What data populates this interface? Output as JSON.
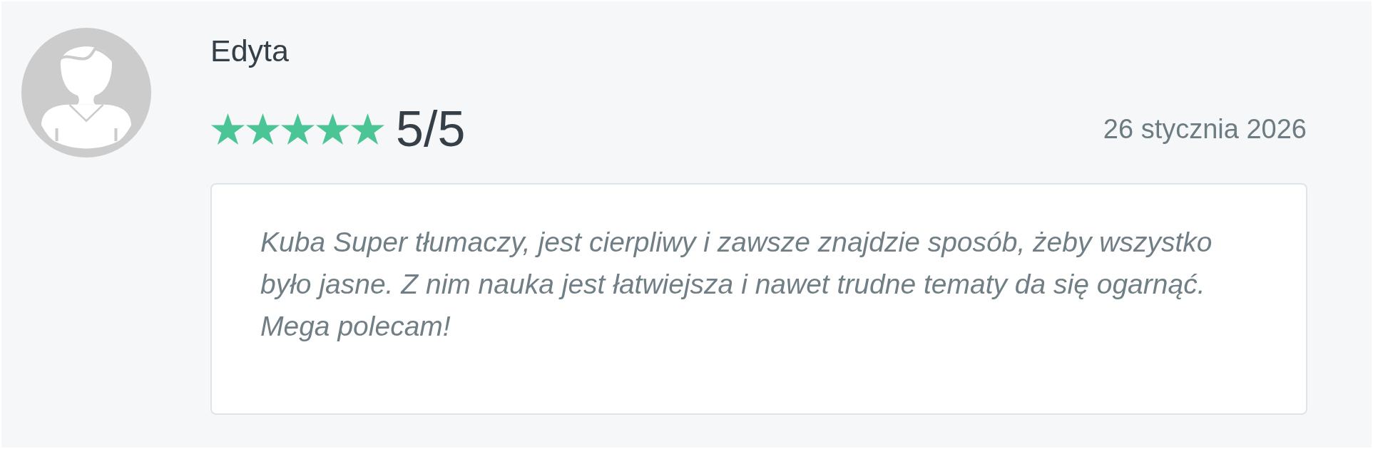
{
  "reviewer": {
    "name": "Edyta"
  },
  "rating": {
    "stars": 5,
    "text": "5/5"
  },
  "date": "26 stycznia 2026",
  "review": {
    "text": "Kuba Super tłumaczy, jest cierpliwy i zawsze znajdzie sposób, żeby wszystko było jasne. Z nim nauka jest łatwiejsza i nawet trudne tematy da się ogarnąć. Mega polecam!"
  }
}
